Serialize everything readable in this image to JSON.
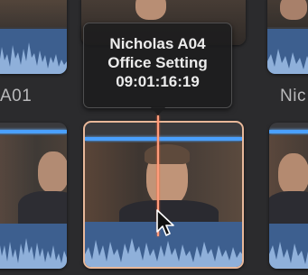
{
  "browser": {
    "row1_labels": [
      "A01",
      "Nic"
    ],
    "tooltip": {
      "name": "Nicholas A04",
      "setting": "Office Setting",
      "timecode": "09:01:16:19"
    }
  },
  "colors": {
    "accent_blue": "#4aa0ff",
    "playhead": "#ff8a63",
    "selected_border": "#e8b89a",
    "waveform": "#5b7fb4"
  }
}
